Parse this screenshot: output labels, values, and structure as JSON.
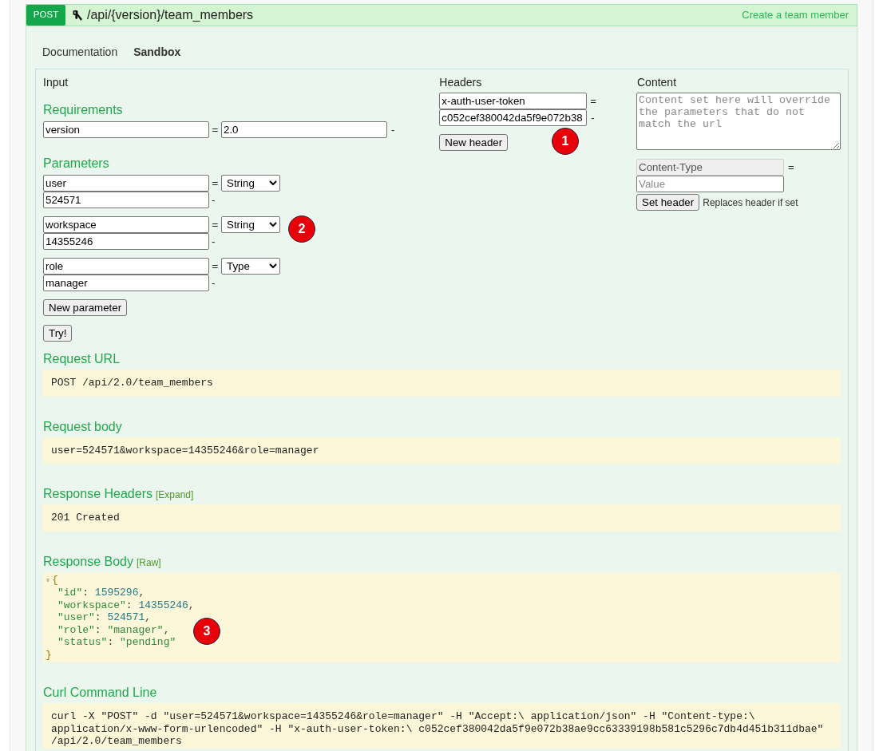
{
  "endpoint": {
    "method": "POST",
    "path": "/api/{version}/team_members",
    "summary": "Create a team member"
  },
  "tabs": [
    {
      "label": "Documentation",
      "selected": false
    },
    {
      "label": "Sandbox",
      "selected": true
    }
  ],
  "input": {
    "title": "Input",
    "requirements": {
      "title": "Requirements",
      "rows": [
        {
          "name": "version",
          "equals": "=",
          "value": "2.0",
          "remove": "-"
        }
      ]
    },
    "parameters": {
      "title": "Parameters",
      "rows": [
        {
          "name": "user",
          "equals": "=",
          "type": "String",
          "value": "524571",
          "remove": "-"
        },
        {
          "name": "workspace",
          "equals": "=",
          "type": "String",
          "value": "14355246",
          "remove": "-"
        },
        {
          "name": "role",
          "equals": "=",
          "type": "Type",
          "value": "manager",
          "remove": "-"
        }
      ]
    },
    "new_parameter_button": "New parameter",
    "try_button": "Try!"
  },
  "headers": {
    "title": "Headers",
    "rows": [
      {
        "name": "x-auth-user-token",
        "equals": "=",
        "value": "c052cef380042da5f9e072b38",
        "remove": "-"
      }
    ],
    "new_header_button": "New header"
  },
  "content": {
    "title": "Content",
    "placeholder": "Content set here will override the parameters that do not match the url",
    "content_type": {
      "value": "Content-Type",
      "disabled": true,
      "equals": "=",
      "value_placeholder": "Value"
    },
    "set_header_button": "Set header",
    "note": "Replaces header if set"
  },
  "results": [
    {
      "kind": "text",
      "title": "Request URL",
      "text": "POST /api/2.0/team_members"
    },
    {
      "kind": "text",
      "title": "Request body",
      "text": "user=524571&workspace=14355246&role=manager"
    },
    {
      "kind": "text",
      "title": "Response Headers",
      "link": "[Expand]",
      "text": "201 Created"
    },
    {
      "kind": "json",
      "title": "Response Body",
      "link": "[Raw]",
      "toggle": "▿",
      "open": "{",
      "lines": [
        [
          {
            "text": "\"id\"",
            "kind": "key"
          },
          {
            "text": ": ",
            "kind": "punct"
          },
          {
            "text": "1595296",
            "kind": "number"
          },
          {
            "text": ",",
            "kind": "punct"
          }
        ],
        [
          {
            "text": "\"workspace\"",
            "kind": "key"
          },
          {
            "text": ": ",
            "kind": "punct"
          },
          {
            "text": "14355246",
            "kind": "number"
          },
          {
            "text": ",",
            "kind": "punct"
          }
        ],
        [
          {
            "text": "\"user\"",
            "kind": "key"
          },
          {
            "text": ": ",
            "kind": "punct"
          },
          {
            "text": "524571",
            "kind": "number"
          },
          {
            "text": ",",
            "kind": "punct"
          }
        ],
        [
          {
            "text": "\"role\"",
            "kind": "key"
          },
          {
            "text": ": ",
            "kind": "punct"
          },
          {
            "text": "\"manager\"",
            "kind": "string"
          },
          {
            "text": ",",
            "kind": "punct"
          }
        ],
        [
          {
            "text": "\"status\"",
            "kind": "key"
          },
          {
            "text": ": ",
            "kind": "punct"
          },
          {
            "text": "\"pending\"",
            "kind": "string"
          }
        ]
      ],
      "close": "}"
    },
    {
      "kind": "text",
      "title": "Curl Command Line",
      "text": "curl -X \"POST\" -d \"user=524571&workspace=14355246&role=manager\" -H \"Accept:\\ application/json\" -H \"Content-type:\\ application/x-www-form-urlencoded\" -H \"x-auth-user-token:\\ c052cef380042da5f9e072b38ae9cc63339198b581c5296c7db4d451b311dbae\" /api/2.0/team_members"
    }
  ],
  "annotations": [
    {
      "label": "1"
    },
    {
      "label": "2"
    },
    {
      "label": "3"
    }
  ]
}
